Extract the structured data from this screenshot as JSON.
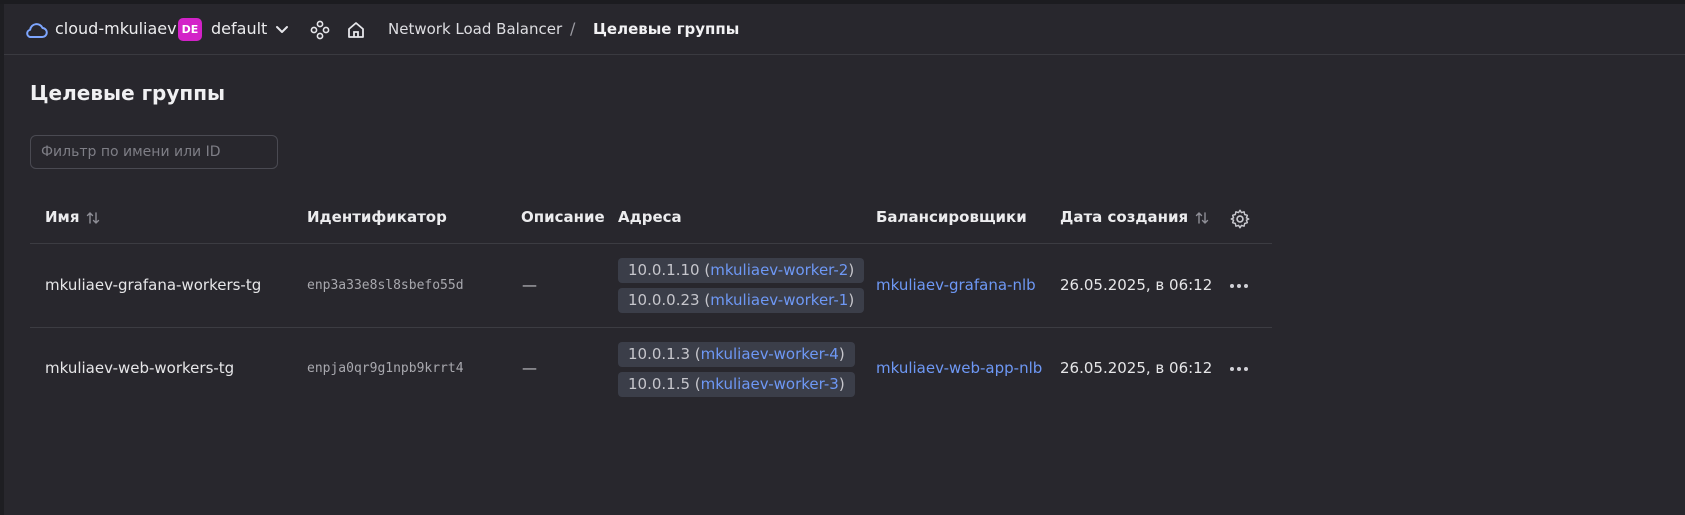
{
  "header": {
    "cloud_name": "cloud-mkuliaev",
    "folder_badge": "DE",
    "folder_name": "default",
    "breadcrumb_service": "Network Load Balancer",
    "breadcrumb_separator": "/",
    "breadcrumb_current": "Целевые группы"
  },
  "page": {
    "title": "Целевые группы"
  },
  "filter": {
    "placeholder": "Фильтр по имени или ID",
    "value": ""
  },
  "table": {
    "columns": {
      "name": "Имя",
      "id": "Идентификатор",
      "description": "Описание",
      "addresses": "Адреса",
      "balancers": "Балансировщики",
      "created": "Дата создания"
    },
    "rows": [
      {
        "name": "mkuliaev-grafana-workers-tg",
        "id": "enp3a33e8sl8sbefo55d",
        "description": "—",
        "addresses": [
          {
            "ip": "10.0.1.10",
            "vm": "mkuliaev-worker-2"
          },
          {
            "ip": "10.0.0.23",
            "vm": "mkuliaev-worker-1"
          }
        ],
        "balancer": "mkuliaev-grafana-nlb",
        "created": "26.05.2025, в 06:12"
      },
      {
        "name": "mkuliaev-web-workers-tg",
        "id": "enpja0qr9g1npb9krrt4",
        "description": "—",
        "addresses": [
          {
            "ip": "10.0.1.3",
            "vm": "mkuliaev-worker-4"
          },
          {
            "ip": "10.0.1.5",
            "vm": "mkuliaev-worker-3"
          }
        ],
        "balancer": "mkuliaev-web-app-nlb",
        "created": "26.05.2025, в 06:12"
      }
    ]
  },
  "colors": {
    "background": "#28272d",
    "link": "#6e98f5",
    "badge": "#d322c8",
    "address_chip": "#3b3e49"
  },
  "icons": [
    "cloud-icon",
    "chevron-down-icon",
    "services-icon",
    "home-icon",
    "sort-icon",
    "gear-icon",
    "more-icon"
  ]
}
